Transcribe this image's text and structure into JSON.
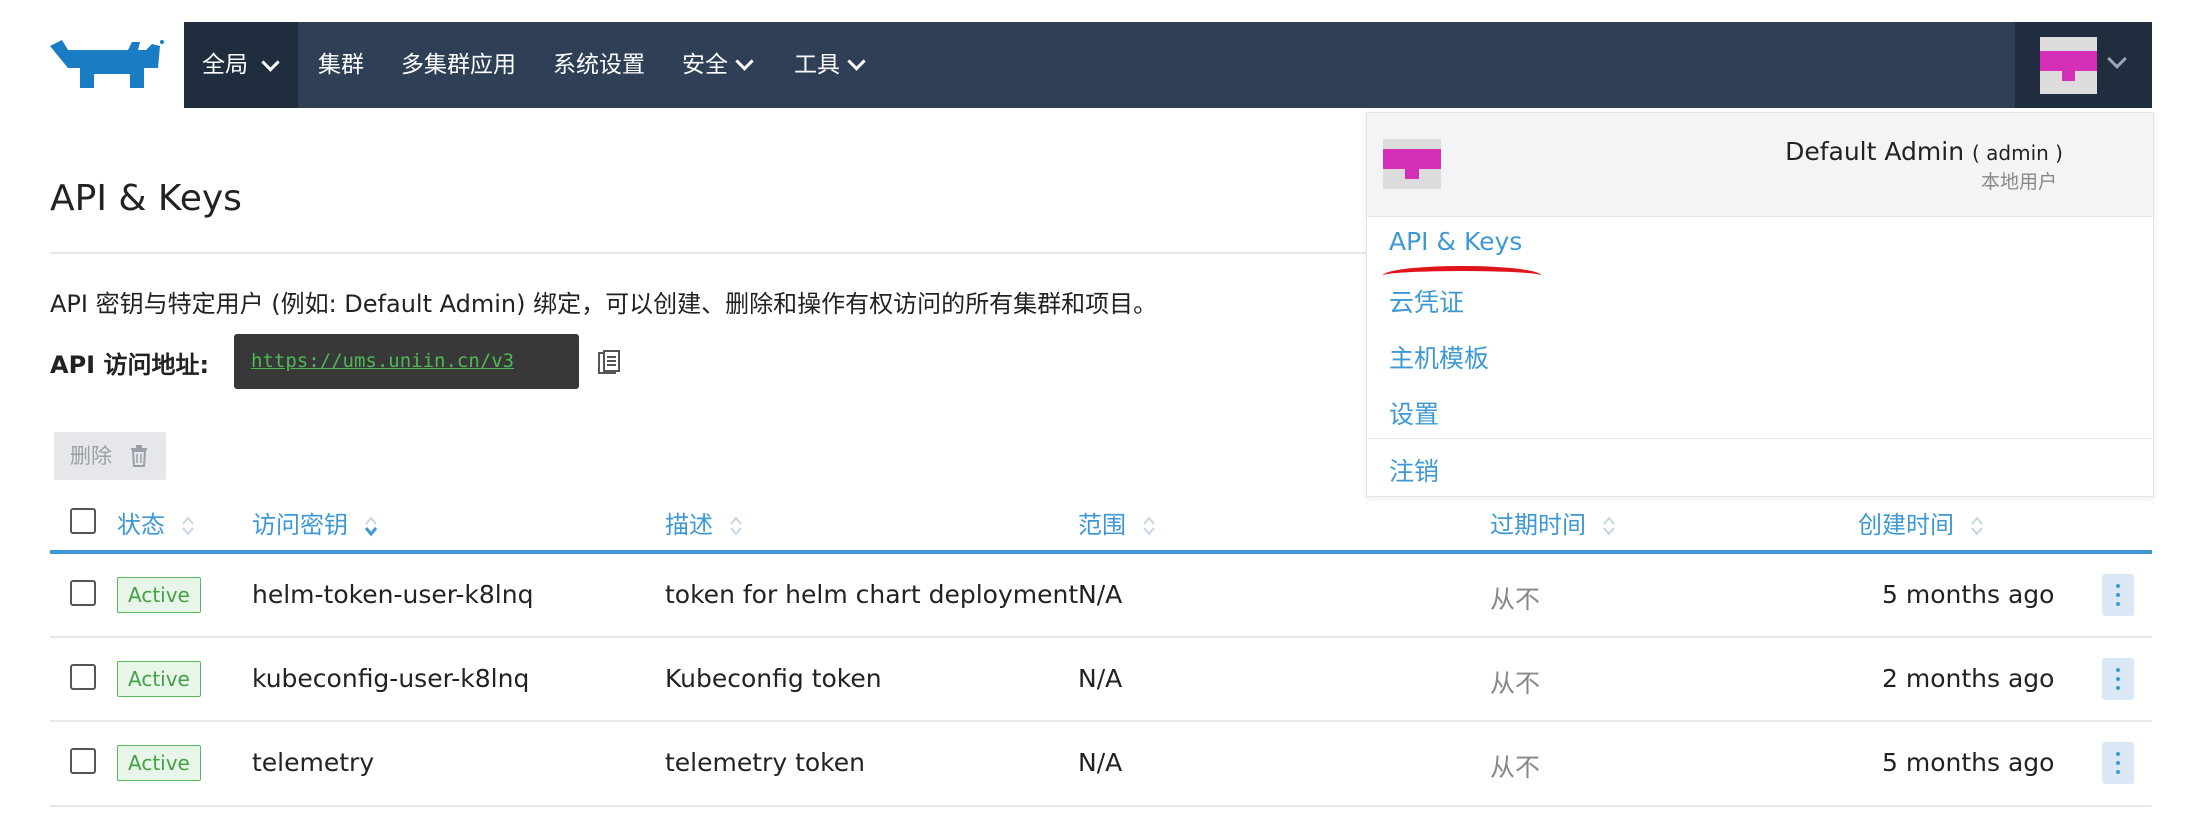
{
  "nav": {
    "global_label": "全局",
    "items": [
      {
        "label": "集群"
      },
      {
        "label": "多集群应用"
      },
      {
        "label": "系统设置"
      },
      {
        "label": "安全"
      },
      {
        "label": "工具"
      }
    ]
  },
  "page": {
    "title": "API & Keys",
    "description": "API 密钥与特定用户 (例如: Default Admin) 绑定，可以创建、删除和操作有权访问的所有集群和项目。",
    "api_label": "API 访问地址:",
    "api_url": "https://ums.uniin.cn/v3",
    "delete_label": "删除"
  },
  "table": {
    "headers": {
      "status": "状态",
      "key": "访问密钥",
      "description": "描述",
      "scope": "范围",
      "expires": "过期时间",
      "created": "创建时间"
    },
    "rows": [
      {
        "status": "Active",
        "key": "helm-token-user-k8lnq",
        "description": "token for helm chart deployment",
        "scope": "N/A",
        "expires": "从不",
        "created": "5 months ago"
      },
      {
        "status": "Active",
        "key": "kubeconfig-user-k8lnq",
        "description": "Kubeconfig token",
        "scope": "N/A",
        "expires": "从不",
        "created": "2 months ago"
      },
      {
        "status": "Active",
        "key": "telemetry",
        "description": "telemetry token",
        "scope": "N/A",
        "expires": "从不",
        "created": "5 months ago"
      }
    ]
  },
  "user_menu": {
    "name": "Default Admin",
    "username": "( admin )",
    "type": "本地用户",
    "items": [
      {
        "label": "API & Keys"
      },
      {
        "label": "云凭证"
      },
      {
        "label": "主机模板"
      },
      {
        "label": "设置"
      },
      {
        "label": "注销"
      }
    ]
  },
  "colors": {
    "nav_bg": "#2f3f56",
    "nav_active_bg": "#202d3e",
    "accent": "#3d98d3",
    "badge_green": "#43a047",
    "avatar_magenta": "#d52fb7",
    "annotation_red": "#e0141b"
  }
}
